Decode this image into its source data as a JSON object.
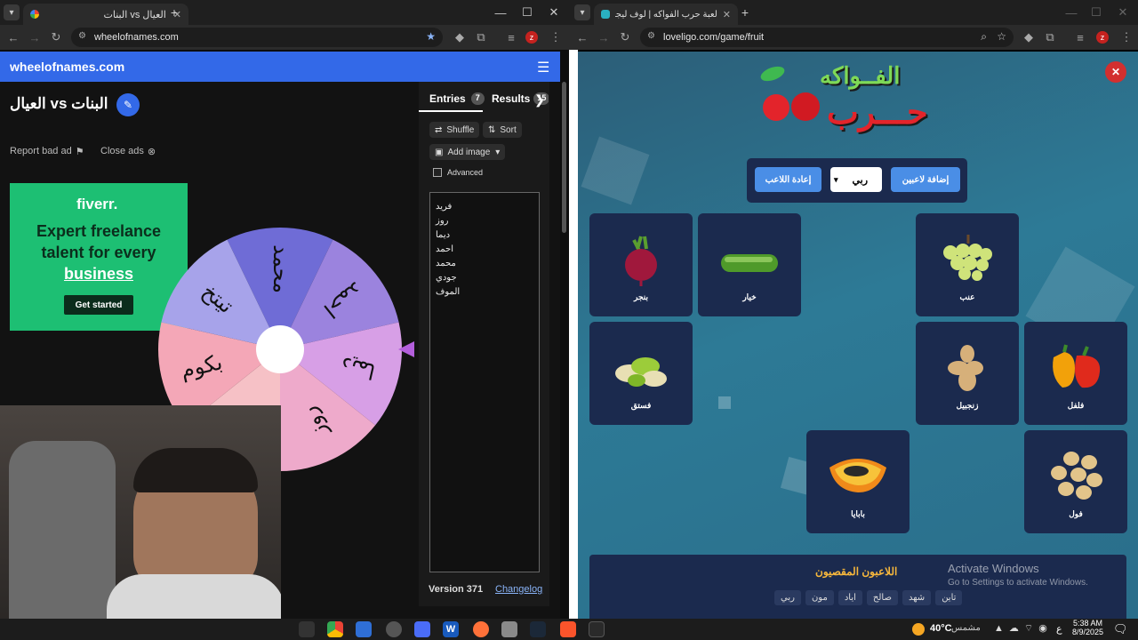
{
  "left_browser": {
    "tab_title": "العيال vs البنات",
    "url": "wheelofnames.com",
    "site_brand": "wheelofnames.com",
    "wheel_title": "البنات vs العيال",
    "report_ad": "Report bad ad",
    "close_ads": "Close ads",
    "ad": {
      "brand": "fiverr.",
      "headline": "Expert freelance talent for every",
      "headline_link": "business",
      "cta": "Get started"
    },
    "tabs": {
      "entries": "Entries",
      "entries_count": "7",
      "results": "Results",
      "results_count": "15"
    },
    "buttons": {
      "shuffle": "Shuffle",
      "sort": "Sort",
      "add_image": "Add image",
      "advanced": "Advanced"
    },
    "entries": [
      "فريد",
      "روز",
      "ديما",
      "احمد",
      "محمد",
      "جودي",
      "الموف"
    ],
    "wheel_segments": [
      {
        "label": "محمد",
        "color": "#6f6cd6"
      },
      {
        "label": "احمد",
        "color": "#9b83de"
      },
      {
        "label": "ديما",
        "color": "#d79fe6"
      },
      {
        "label": "روز",
        "color": "#eeaacb"
      },
      {
        "label": "",
        "color": "#f6c1c6"
      },
      {
        "label": "بكوم",
        "color": "#f4a7b7"
      },
      {
        "label": "تيتخ",
        "color": "#a7a3ea"
      }
    ],
    "version": "Version 371",
    "changelog": "Changelog"
  },
  "right_browser": {
    "tab_title": "لعبة حرب الفواكه | لوف ليجو يوفر...",
    "url": "loveligo.com/game/fruit",
    "logo_line1": "الفــواكه",
    "logo_line2": "حـــرب",
    "btn_add": "إضافة لاعبين",
    "player_select": "ربي",
    "btn_reset": "إعادة اللاعب",
    "fruits": [
      {
        "name": "بنجر",
        "icon": "beet-icon"
      },
      {
        "name": "خيار",
        "icon": "cucumber-icon"
      },
      {
        "name": "عنب",
        "icon": "grapes-icon"
      },
      {
        "name": "فستق",
        "icon": "pistachio-icon"
      },
      {
        "name": "زنجبيل",
        "icon": "ginger-icon"
      },
      {
        "name": "فلفل",
        "icon": "pepper-icon"
      },
      {
        "name": "بابايا",
        "icon": "papaya-icon"
      },
      {
        "name": "فول",
        "icon": "beans-icon"
      }
    ],
    "eliminated_title": "اللاعبون المقصيون",
    "eliminated": [
      "ربي",
      "مون",
      "اياد",
      "صالح",
      "شهد",
      "تاين"
    ],
    "activate_title": "Activate Windows",
    "activate_sub": "Go to Settings to activate Windows."
  },
  "taskbar": {
    "weather": "40°C",
    "weather_desc": "مشمس",
    "lang": "ع",
    "time": "5:38 AM",
    "date": "8/9/2025"
  },
  "colors": {
    "wheel_header": "#3369e8",
    "game_bg": "#2d7a96",
    "card_bg": "#1b2a4e",
    "fiverr_green": "#1dbf73"
  }
}
